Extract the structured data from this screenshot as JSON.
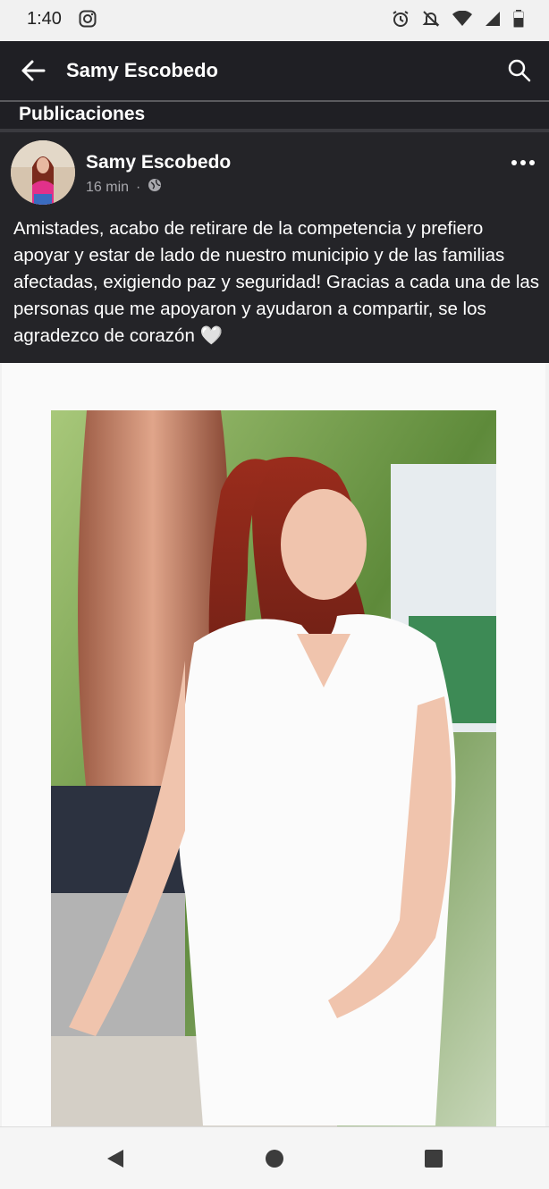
{
  "status_bar": {
    "time": "1:40",
    "icons": [
      "instagram-icon",
      "alarm-icon",
      "notifications-off-icon",
      "wifi-icon",
      "signal-icon",
      "battery-icon"
    ]
  },
  "header": {
    "title": "Samy Escobedo",
    "back_icon": "arrow-left-icon",
    "search_icon": "search-icon"
  },
  "section": {
    "title": "Publicaciones"
  },
  "post": {
    "author": "Samy Escobedo",
    "time_ago": "16 min",
    "separator": "·",
    "privacy_icon": "globe-icon",
    "more_icon": "more-options-icon",
    "text": "Amistades, acabo de retirare de la competencia y prefiero apoyar y estar de lado de nuestro municipio y de las familias afectadas, exigiendo paz y seguridad! Gracias a cada una de las personas que me apoyaron y ayudaron a compartir, se los agradezco de corazón 🤍"
  },
  "nav_bar": {
    "icons": [
      "nav-back-icon",
      "nav-home-icon",
      "nav-recents-icon"
    ]
  },
  "colors": {
    "header_bg": "#1f1f24",
    "post_bg": "#242428",
    "text": "#ffffff",
    "meta_text": "#a8a8ad"
  }
}
